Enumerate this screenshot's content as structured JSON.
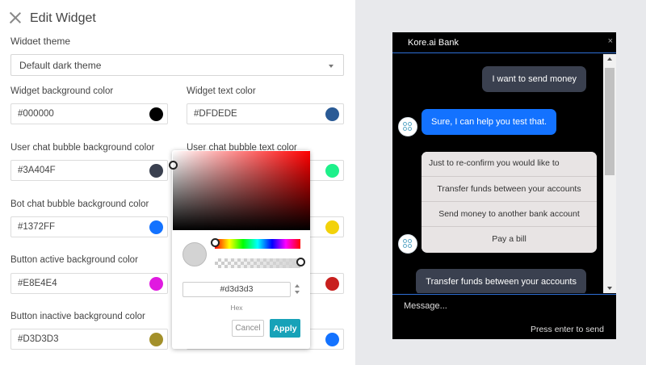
{
  "editor": {
    "title": "Edit Widget",
    "theme_label": "Widget theme",
    "theme_value": "Default dark theme"
  },
  "fields": [
    {
      "label": "Widget background color",
      "value": "#000000",
      "color": "#000000"
    },
    {
      "label": "Widget text color",
      "value": "#DFDEDE",
      "color": "#2a5a95"
    },
    {
      "label": "User chat bubble background color",
      "value": "#3A404F",
      "color": "#3a404f"
    },
    {
      "label": "User chat bubble text color",
      "value": "",
      "color": "#1ef08a"
    },
    {
      "label": "Bot chat bubble background color",
      "value": "#1372FF",
      "color": "#1372ff"
    },
    {
      "label": "",
      "value": "",
      "color": "#f2d20a"
    },
    {
      "label": "Button active background color",
      "value": "#E8E4E4",
      "color": "#e01ae0"
    },
    {
      "label": "",
      "value": "",
      "color": "#c8201e"
    },
    {
      "label": "Button inactive background color",
      "value": "#D3D3D3",
      "color": "#a3902a"
    },
    {
      "label": "",
      "value": "",
      "color": "#1372ff"
    }
  ],
  "picker": {
    "hex_value": "#d3d3d3",
    "hex_label": "Hex",
    "cancel_label": "Cancel",
    "apply_label": "Apply",
    "selected_color": "#d3d3d3"
  },
  "chat": {
    "title": "Kore.ai Bank",
    "close_glyph": "×",
    "messages": {
      "user1": "I want to send money",
      "bot1": "Sure, I can help you test that.",
      "options_prompt": "Just to re-confirm you would like to",
      "options": [
        "Transfer funds between your accounts",
        "Send money to another bank account",
        "Pay a bill"
      ],
      "user2": "Transfer funds between your accounts"
    },
    "input_placeholder": "Message...",
    "send_hint": "Press enter to send"
  }
}
